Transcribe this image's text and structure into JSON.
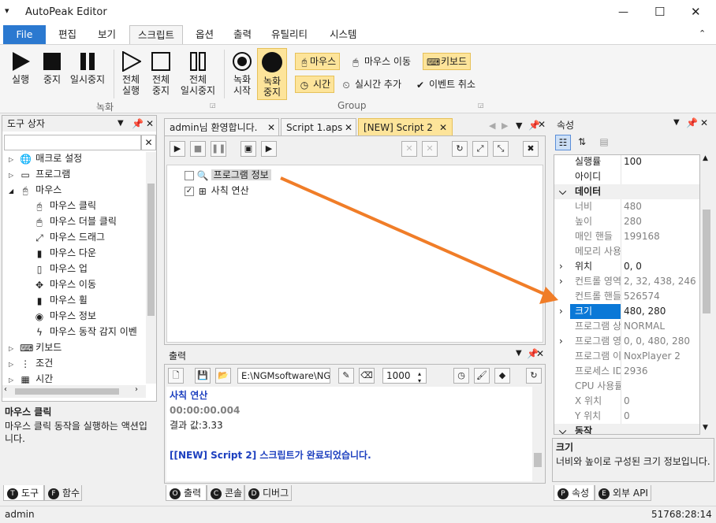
{
  "window": {
    "title": "AutoPeak Editor",
    "min": "—",
    "max": "☐",
    "close": "✕"
  },
  "menu": [
    "File",
    "편집",
    "보기",
    "스크립트",
    "옵션",
    "출력",
    "유틸리티",
    "시스템"
  ],
  "ribbon": {
    "run": "실행",
    "stop": "중지",
    "pause": "일시중지",
    "run_all_1": "전체",
    "run_all_2": "실행",
    "stop_all_1": "전체",
    "stop_all_2": "중지",
    "pause_all_1": "전체",
    "pause_all_2": "일시중지",
    "rec_start_1": "녹화",
    "rec_start_2": "시작",
    "rec_stop_1": "녹화",
    "rec_stop_2": "중지",
    "mouse": "마우스",
    "mouse_move": "마우스 이동",
    "keyboard": "키보드",
    "time": "시간",
    "realtime": "실시간 추가",
    "event_cancel": "이벤트 취소",
    "group_rec": "녹화",
    "group_group": "Group"
  },
  "toolbox": {
    "title": "도구 상자",
    "search_value": "",
    "items": [
      {
        "label": "매크로 설정"
      },
      {
        "label": "프로그램"
      },
      {
        "label": "마우스"
      },
      {
        "label": "마우스 클릭"
      },
      {
        "label": "마우스 더블 클릭"
      },
      {
        "label": "마우스 드래그"
      },
      {
        "label": "마우스 다운"
      },
      {
        "label": "마우스 업"
      },
      {
        "label": "마우스 이동"
      },
      {
        "label": "마우스 휠"
      },
      {
        "label": "마우스 정보"
      },
      {
        "label": "마우스 동작 감지 이벤"
      },
      {
        "label": "키보드"
      },
      {
        "label": "조건"
      },
      {
        "label": "시간"
      }
    ],
    "desc_title": "마우스 클릭",
    "desc_text": "마우스 클릭 동작을 실행하는 액션입니다.",
    "tabs": [
      "도구",
      "함수"
    ],
    "tab_icons": [
      "T",
      "F"
    ]
  },
  "editor": {
    "tabs": [
      "admin님 환영합니다.",
      "Script 1.aps",
      "[NEW] Script 2"
    ],
    "nodes": [
      {
        "label": "프로그램 정보"
      },
      {
        "label": "사칙 연산"
      }
    ]
  },
  "output": {
    "title": "출력",
    "path": "E:\\NGMsoftware\\NG",
    "number": "1000",
    "lines": [
      "사칙 연산",
      "00:00:00.004",
      "결과 값:3.33",
      "",
      "[[NEW] Script 2] 스크립트가 완료되었습니다."
    ],
    "tabs": [
      "출력",
      "콘솔",
      "디버그"
    ],
    "tab_icons": [
      "O",
      "C",
      "D"
    ]
  },
  "properties": {
    "title": "속성",
    "rows": [
      {
        "k": "실행률",
        "v": "100"
      },
      {
        "k": "아이디",
        "v": ""
      },
      {
        "k": "데이터",
        "v": ""
      },
      {
        "k": "너비",
        "v": "480"
      },
      {
        "k": "높이",
        "v": "280"
      },
      {
        "k": "매인 핸들",
        "v": "199168"
      },
      {
        "k": "메모리 사용",
        "v": ""
      },
      {
        "k": "위치",
        "v": "0, 0"
      },
      {
        "k": "컨트롤 영역",
        "v": "2, 32, 438, 246"
      },
      {
        "k": "컨트롤 핸들",
        "v": "526574"
      },
      {
        "k": "크기",
        "v": "480, 280"
      },
      {
        "k": "프로그램 상태",
        "v": "NORMAL"
      },
      {
        "k": "프로그램 영역",
        "v": "0, 0, 480, 280"
      },
      {
        "k": "프로그램 이름",
        "v": "NoxPlayer 2"
      },
      {
        "k": "프로세스 ID",
        "v": "2936"
      },
      {
        "k": "CPU 사용률",
        "v": ""
      },
      {
        "k": "X 위치",
        "v": "0"
      },
      {
        "k": "Y 위치",
        "v": "0"
      },
      {
        "k": "동작",
        "v": ""
      }
    ],
    "desc_title": "크기",
    "desc_text": "너비와 높이로 구성된 크기 정보입니다.",
    "tabs": [
      "속성",
      "외부 API"
    ],
    "tab_icons": [
      "P",
      "E"
    ]
  },
  "status": {
    "user": "admin",
    "time": "51768:28:14"
  },
  "colors": {
    "accent": "#2b79d0",
    "arrow": "#f07d28",
    "highlight": "#fde49a"
  }
}
